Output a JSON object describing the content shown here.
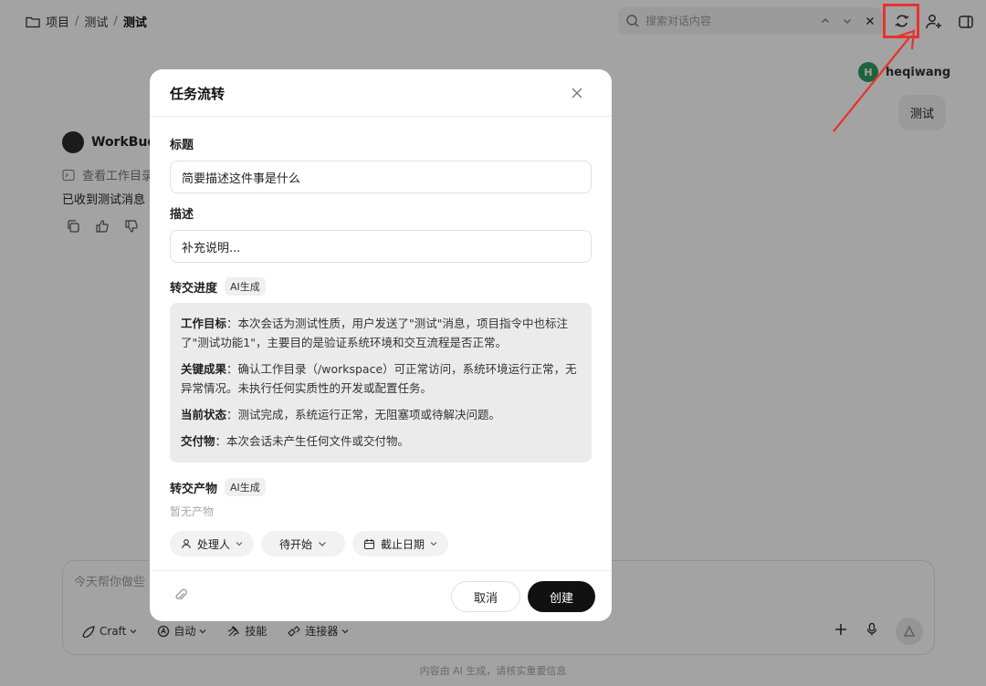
{
  "breadcrumb": {
    "root": "项目",
    "sep1": "/",
    "mid": "测试",
    "sep2": "/",
    "current": "测试"
  },
  "search": {
    "placeholder": "搜索对话内容"
  },
  "chat": {
    "user_name": "heqiwang",
    "user_avatar_letter": "H",
    "user_message": "测试",
    "bot_name": "WorkBudd",
    "bot_tool_text": "查看工作目录",
    "bot_message": "已收到测试消息"
  },
  "composer": {
    "placeholder": "今天帮你做些",
    "tools": {
      "craft": "Craft",
      "auto": "自动",
      "skills": "技能",
      "connector": "连接器"
    }
  },
  "footer_note": "内容由 AI 生成，请核实重要信息",
  "modal": {
    "title": "任务流转",
    "title_label": "标题",
    "title_input": "简要描述这件事是什么",
    "desc_label": "描述",
    "desc_input": "补充说明...",
    "progress_label": "转交进度",
    "ai_badge": "AI生成",
    "summary": {
      "goal_label": "工作目标",
      "goal_text": "：本次会话为测试性质，用户发送了\"测试\"消息，项目指令中也标注了\"测试功能1\"，主要目的是验证系统环境和交互流程是否正常。",
      "result_label": "关键成果",
      "result_text": "：确认工作目录（/workspace）可正常访问，系统环境运行正常，无异常情况。未执行任何实质性的开发或配置任务。",
      "status_label": "当前状态",
      "status_text": "：测试完成，系统运行正常，无阻塞项或待解决问题。",
      "deliver_label": "交付物",
      "deliver_text": "：本次会话未产生任何文件或交付物。"
    },
    "artifacts_label": "转交产物",
    "artifacts_badge": "AI生成",
    "artifacts_empty": "暂无产物",
    "assignee": "处理人",
    "status": "待开始",
    "due_date": "截止日期",
    "cancel": "取消",
    "create": "创建"
  },
  "colors": {
    "highlight": "#e8322d",
    "primary_button": "#111111",
    "avatar": "#2e9b5e"
  }
}
